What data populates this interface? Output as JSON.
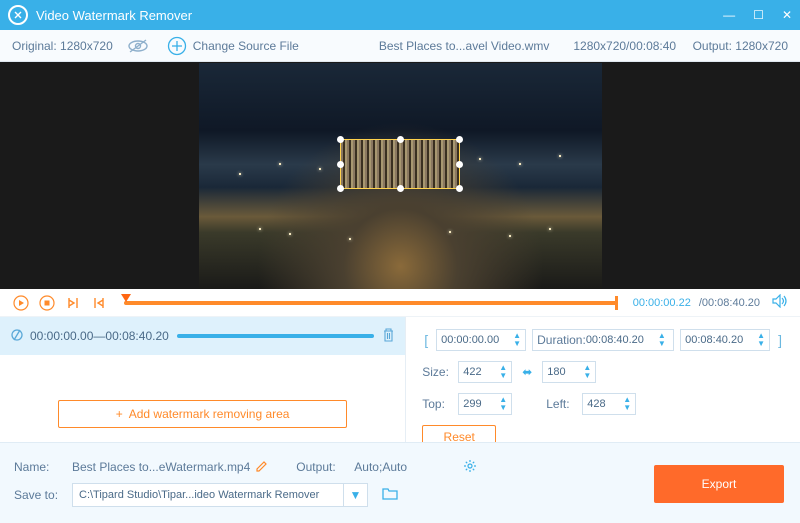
{
  "app": {
    "title": "Video Watermark Remover"
  },
  "header": {
    "original_label": "Original:",
    "original_dims": "1280x720",
    "change_source": "Change Source File",
    "filename": "Best Places to...avel Video.wmv",
    "file_dims_time": "1280x720/00:08:40",
    "output_label": "Output:",
    "output_dims": "1280x720"
  },
  "controls": {
    "cur_time": "00:00:00.22",
    "total_time": "/00:08:40.20"
  },
  "segment": {
    "start": "00:00:00.00",
    "sep": " — ",
    "end": "00:08:40.20"
  },
  "add_area": "Add watermark removing area",
  "range": {
    "start": "00:00:00.00",
    "duration_label": "Duration:",
    "duration": "00:08:40.20",
    "end": "00:08:40.20"
  },
  "size": {
    "label": "Size:",
    "w": "422",
    "h": "180"
  },
  "pos": {
    "top_label": "Top:",
    "top": "299",
    "left_label": "Left:",
    "left": "428"
  },
  "reset": "Reset",
  "footer": {
    "name_label": "Name:",
    "name": "Best Places to...eWatermark.mp4",
    "output_label": "Output:",
    "output": "Auto;Auto",
    "save_label": "Save to:",
    "save_path": "C:\\Tipard Studio\\Tipar...ideo Watermark Remover",
    "export": "Export"
  }
}
